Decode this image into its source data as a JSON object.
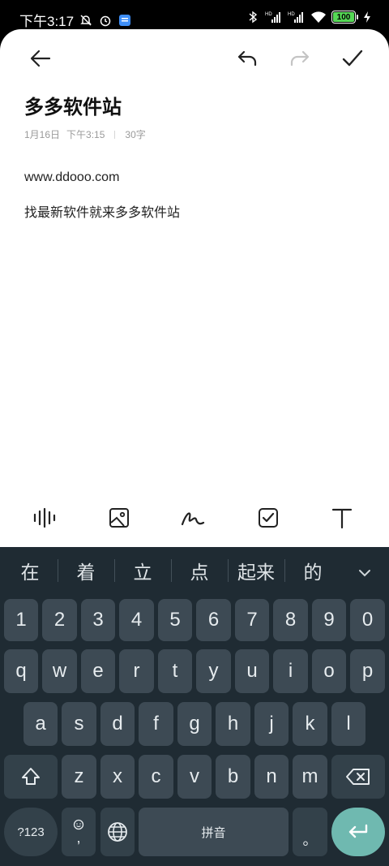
{
  "status_bar": {
    "time": "下午3:17",
    "battery": "100",
    "icons": [
      "mute-bell-icon",
      "alarm-icon",
      "app-notification-icon",
      "bluetooth-icon",
      "hd-signal-1-icon",
      "hd-signal-2-icon",
      "wifi-icon",
      "charging-icon"
    ]
  },
  "note": {
    "title": "多多软件站",
    "date": "1月16日",
    "time": "下午3:15",
    "word_count": "30字",
    "lines": [
      "www.ddooo.com",
      "找最新软件就来多多软件站"
    ]
  },
  "toolbar": {
    "icons": [
      "back-arrow-icon",
      "undo-icon",
      "redo-icon",
      "confirm-check-icon"
    ]
  },
  "bottom_tools": {
    "icons": [
      "voice-wave-icon",
      "image-icon",
      "handwriting-icon",
      "checklist-icon",
      "text-format-icon"
    ]
  },
  "keyboard": {
    "candidates": [
      "在",
      "着",
      "立",
      "点",
      "起来",
      "的"
    ],
    "number_row": [
      "1",
      "2",
      "3",
      "4",
      "5",
      "6",
      "7",
      "8",
      "9",
      "0"
    ],
    "row1": [
      "q",
      "w",
      "e",
      "r",
      "t",
      "y",
      "u",
      "i",
      "o",
      "p"
    ],
    "row2": [
      "a",
      "s",
      "d",
      "f",
      "g",
      "h",
      "j",
      "k",
      "l"
    ],
    "row3": [
      "z",
      "x",
      "c",
      "v",
      "b",
      "n",
      "m"
    ],
    "symbols_label": "?123",
    "comma_label": ",",
    "space_label": "拼音",
    "period_label": "。",
    "colors": {
      "background": "#1f2b33",
      "key": "#3d4a54",
      "enter": "#6fb9b0"
    }
  }
}
